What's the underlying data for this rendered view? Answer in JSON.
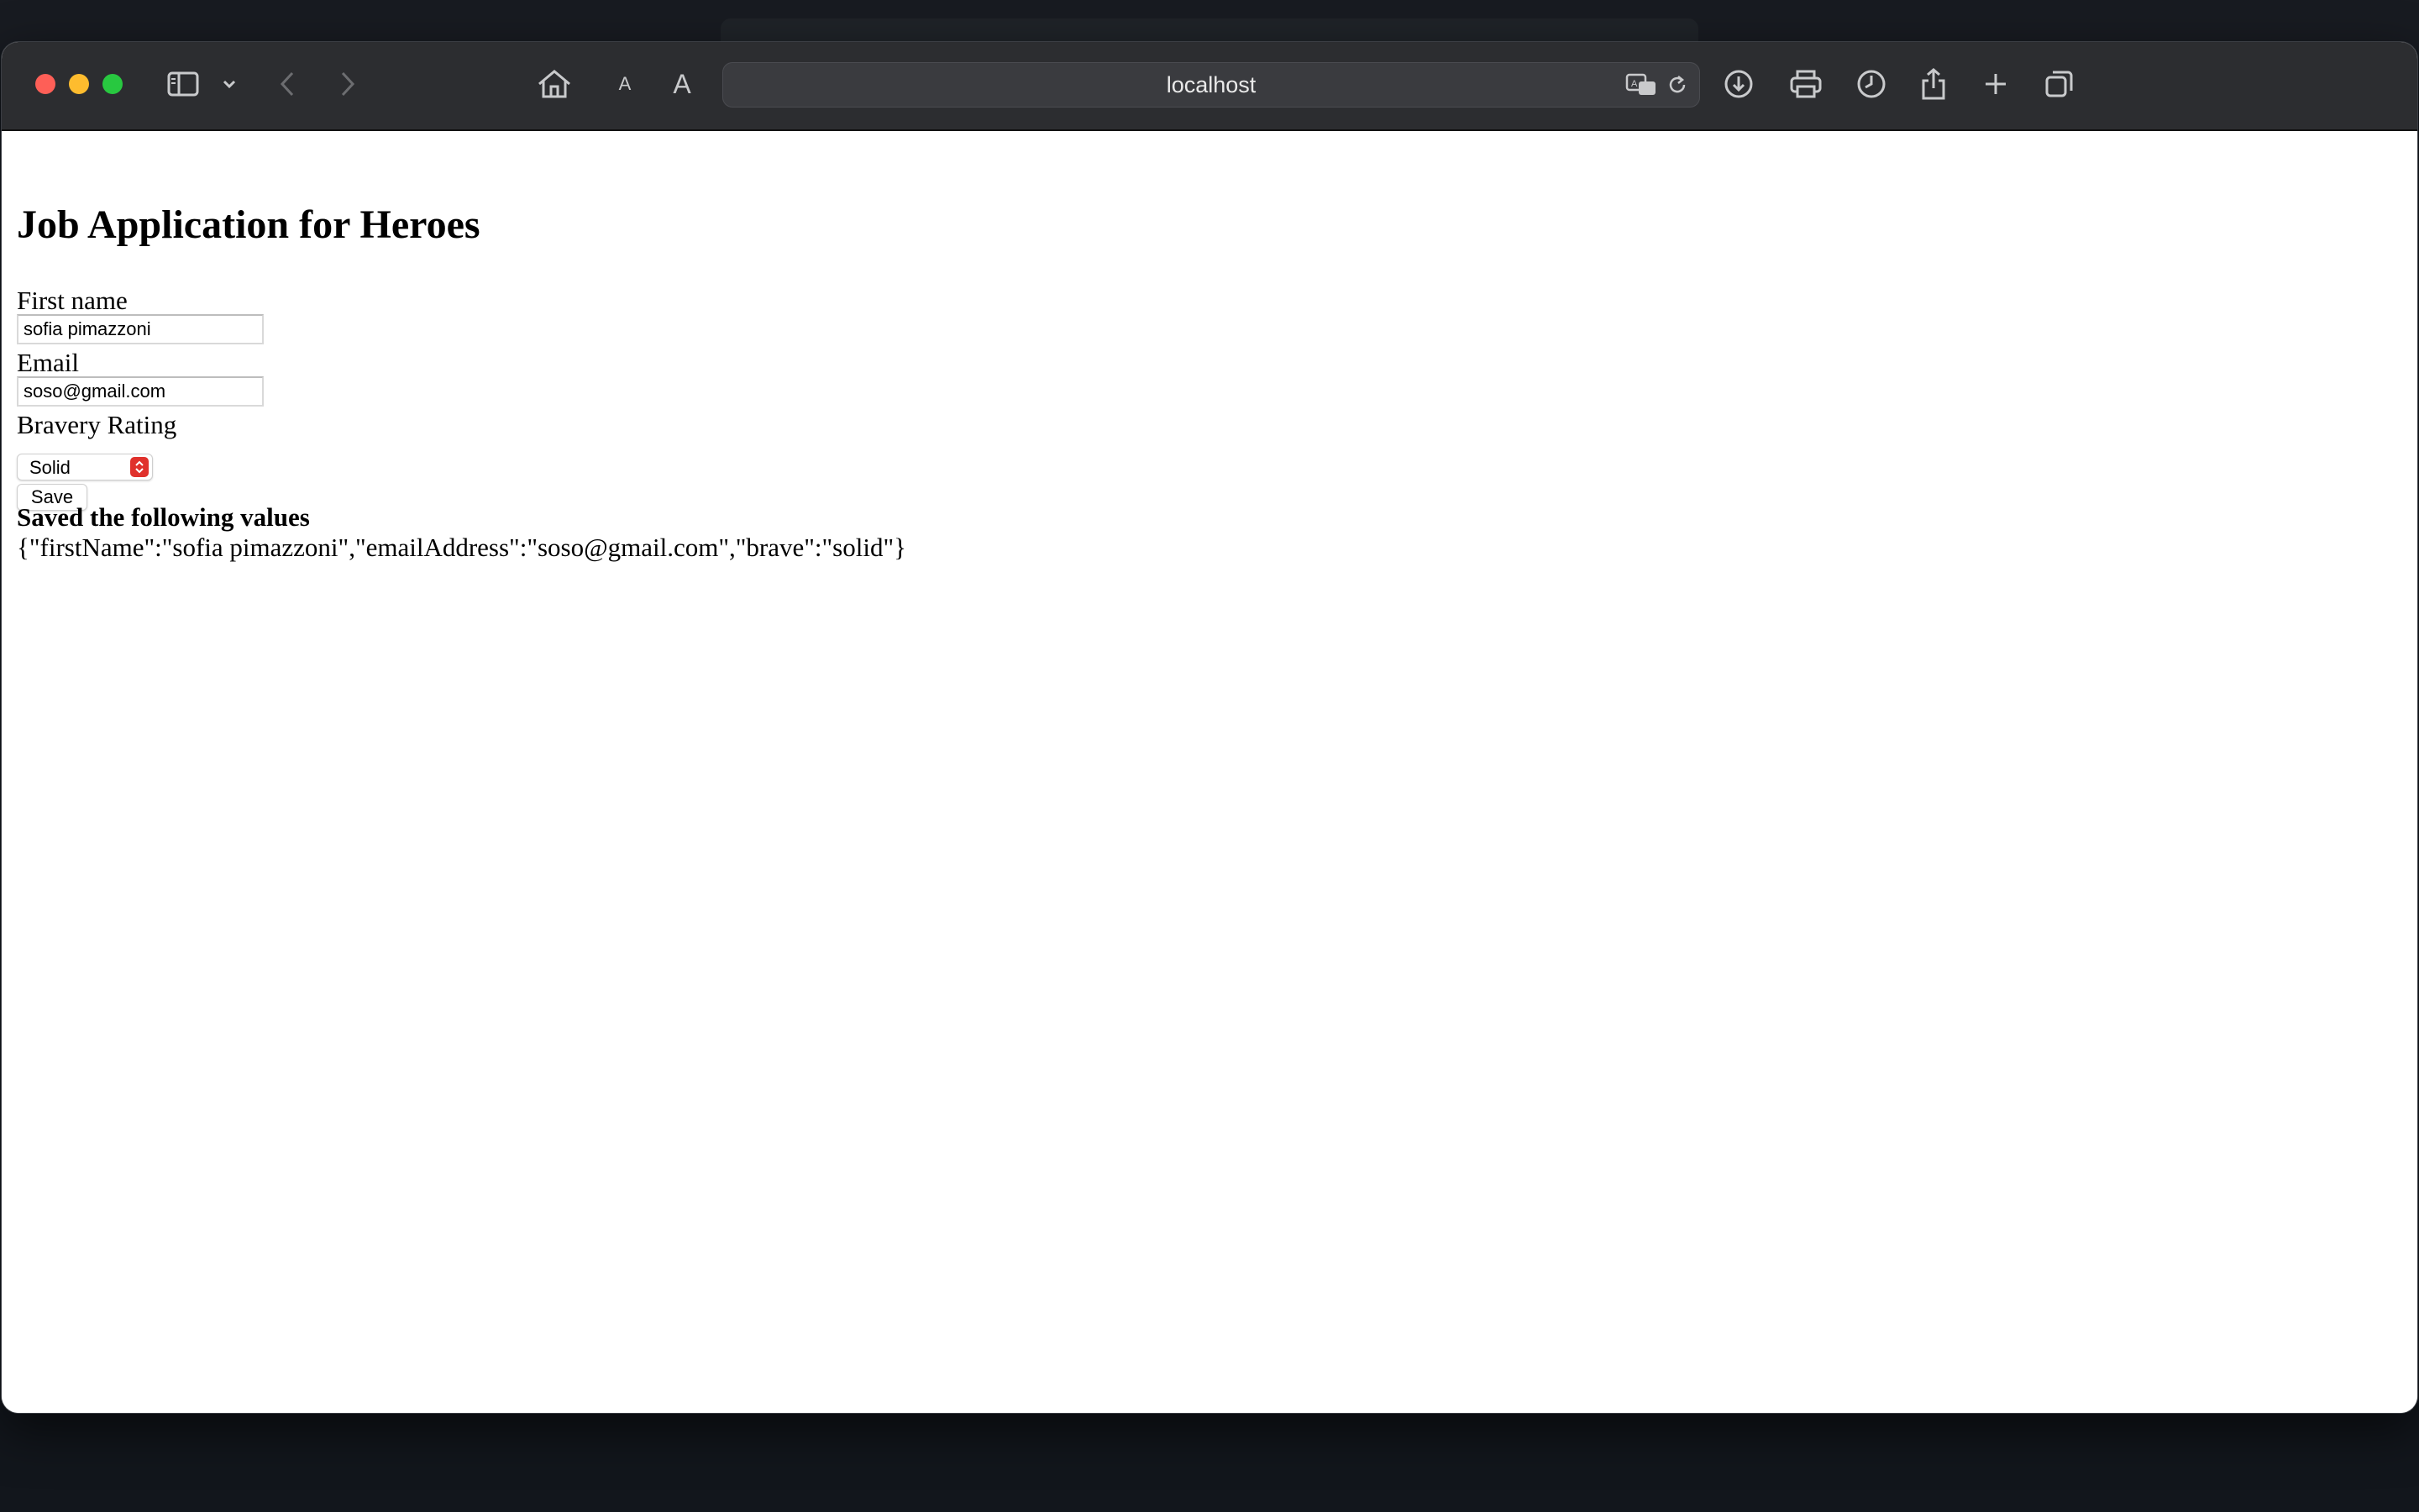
{
  "browser": {
    "url": "localhost",
    "toolbar_icons": [
      "sidebar-icon",
      "chevron-down-icon",
      "back-icon",
      "forward-icon",
      "home-icon",
      "text-smaller-icon",
      "text-larger-icon",
      "translate-icon",
      "reload-icon",
      "download-icon",
      "print-icon",
      "history-icon",
      "share-icon",
      "new-tab-icon",
      "tabs-overview-icon"
    ],
    "text_small_label": "A",
    "text_large_label": "A"
  },
  "page": {
    "title": "Job Application for Heroes",
    "first_name_label": "First name",
    "first_name_value": "sofia pimazzoni",
    "email_label": "Email",
    "email_value": "soso@gmail.com",
    "bravery_label": "Bravery Rating",
    "bravery_value": "Solid",
    "save_label": "Save",
    "saved_heading": "Saved the following values",
    "saved_json": "{\"firstName\":\"sofia pimazzoni\",\"emailAddress\":\"soso@gmail.com\",\"brave\":\"solid\"}"
  },
  "colors": {
    "toolbar": "#2c2d30",
    "select_accent": "#e0312c",
    "close": "#fe5f57",
    "minimize": "#febc2e",
    "maximize": "#28c840"
  }
}
